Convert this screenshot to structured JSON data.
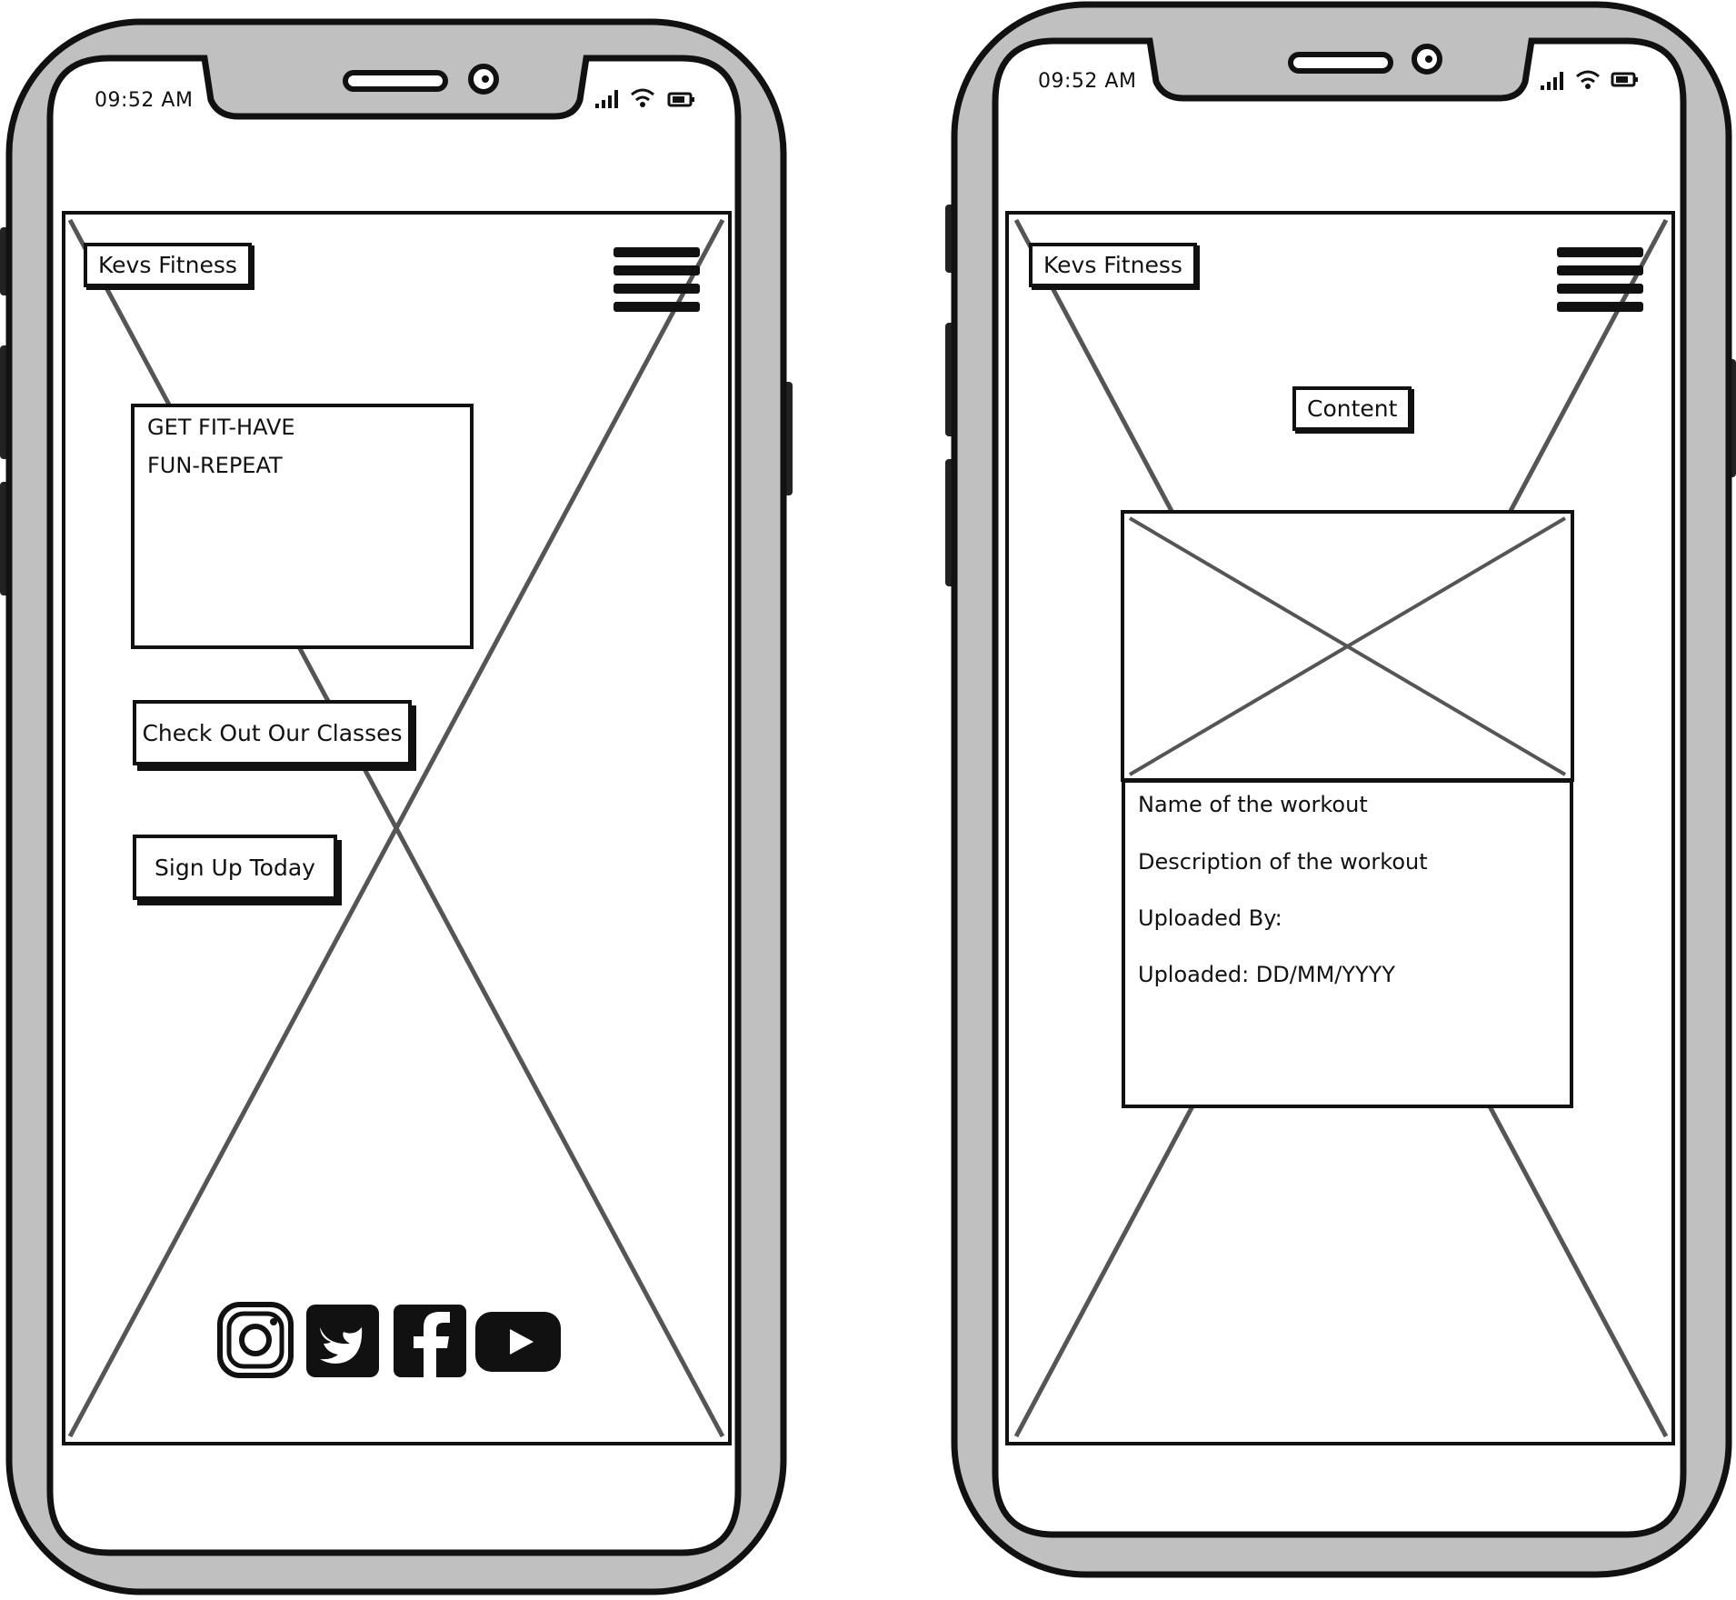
{
  "colors": {
    "frame": "#c0c0c0",
    "ink": "#111111",
    "cross": "#555555",
    "screen": "#ffffff"
  },
  "left_phone": {
    "status_time": "09:52 AM",
    "brand": "Kevs Fitness",
    "hero_line1": "GET FIT-HAVE",
    "hero_line2": "FUN-REPEAT",
    "btn_classes": "Check Out Our Classes",
    "btn_signup": "Sign Up Today",
    "social_icons": [
      "instagram-icon",
      "twitter-icon",
      "facebook-icon",
      "youtube-icon"
    ]
  },
  "right_phone": {
    "status_time": "09:52 AM",
    "brand": "Kevs Fitness",
    "content_label": "Content",
    "card": {
      "name": "Name of the workout",
      "description": "Description of the workout",
      "uploaded_by": "Uploaded By:",
      "uploaded_date": "Uploaded: DD/MM/YYYY"
    }
  }
}
